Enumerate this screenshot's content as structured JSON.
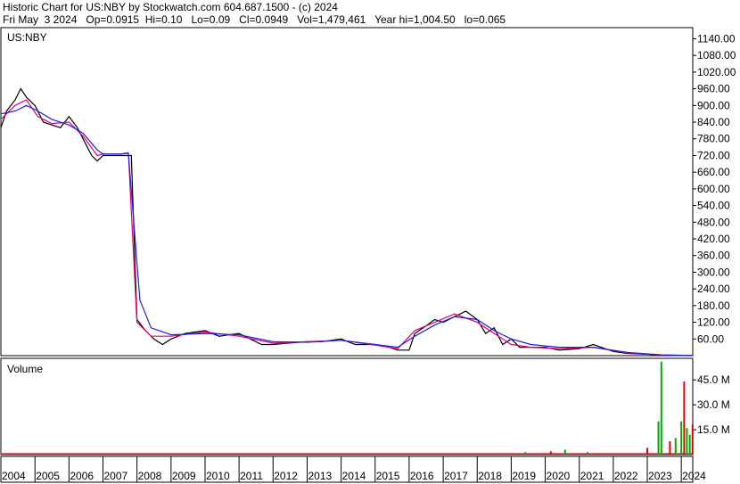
{
  "header": {
    "line1": "Historic Chart for US:NBY by Stockwatch.com 604.687.1500 - (c) 2024",
    "line2": "Fri May  3 2024   Op=0.0915  Hi=0.10   Lo=0.09   Cl=0.0949   Vol=1,479,461   Year hi=1,004.50   lo=0.065"
  },
  "colors": {
    "price": "#000000",
    "ma_short": "#e0007a",
    "ma_long": "#2020e0",
    "volume": "#00aa00",
    "volume_down": "#dd0000"
  },
  "chart_data": [
    {
      "type": "line",
      "title": "US:NBY",
      "ylim": [
        0,
        1180
      ],
      "yticks": [
        1140,
        1080,
        1020,
        960,
        900,
        840,
        780,
        720,
        660,
        600,
        540,
        480,
        420,
        360,
        300,
        240,
        180,
        120,
        60
      ],
      "x_ticks": [
        "2004",
        "2005",
        "2006",
        "2007",
        "2008",
        "2009",
        "2010",
        "2011",
        "2012",
        "2013",
        "2014",
        "2015",
        "2016",
        "2017",
        "2018",
        "2019",
        "2020",
        "2021",
        "2022",
        "2023",
        "2024"
      ],
      "x_range": [
        "2004-01-01",
        "2024-05-03"
      ],
      "series": [
        {
          "role": "price",
          "x": [
            "2004-01-01",
            "2004-03-01",
            "2004-06-01",
            "2004-08-01",
            "2004-10-01",
            "2005-01-01",
            "2005-04-01",
            "2005-07-01",
            "2005-10-01",
            "2006-01-01",
            "2006-04-01",
            "2006-06-01",
            "2006-09-01",
            "2006-11-01",
            "2007-01-01",
            "2007-06-01",
            "2007-09-01",
            "2007-11-01",
            "2008-01-01",
            "2008-04-01",
            "2008-07-01",
            "2008-10-01",
            "2009-01-01",
            "2009-06-01",
            "2010-01-01",
            "2010-06-01",
            "2011-01-01",
            "2011-05-01",
            "2011-09-01",
            "2012-01-01",
            "2012-06-01",
            "2013-01-01",
            "2013-06-01",
            "2014-01-01",
            "2014-06-01",
            "2015-01-01",
            "2015-06-01",
            "2015-09-01",
            "2016-01-01",
            "2016-03-01",
            "2016-06-01",
            "2016-10-01",
            "2017-01-01",
            "2017-05-01",
            "2017-09-01",
            "2018-01-01",
            "2018-04-01",
            "2018-07-01",
            "2018-10-01",
            "2019-01-01",
            "2019-04-01",
            "2019-08-01",
            "2020-01-01",
            "2020-06-01",
            "2021-01-01",
            "2021-06-01",
            "2022-01-01",
            "2022-06-01",
            "2023-01-01",
            "2023-06-01",
            "2024-01-01",
            "2024-05-03"
          ],
          "y": [
            820,
            880,
            920,
            960,
            930,
            900,
            840,
            830,
            820,
            860,
            820,
            780,
            720,
            700,
            720,
            720,
            720,
            720,
            130,
            90,
            60,
            40,
            60,
            80,
            90,
            70,
            80,
            60,
            40,
            40,
            45,
            50,
            50,
            60,
            40,
            40,
            30,
            20,
            20,
            80,
            100,
            130,
            120,
            140,
            160,
            130,
            80,
            100,
            40,
            60,
            30,
            30,
            30,
            20,
            25,
            40,
            15,
            8,
            5,
            2,
            0.2,
            0.1
          ]
        },
        {
          "role": "ma_short",
          "x": [
            "2004-01-01",
            "2004-06-01",
            "2004-10-01",
            "2005-02-01",
            "2005-07-01",
            "2006-01-01",
            "2006-06-01",
            "2006-11-01",
            "2007-01-01",
            "2007-07-01",
            "2007-10-01",
            "2008-01-01",
            "2008-06-01",
            "2009-01-01",
            "2010-01-01",
            "2011-01-01",
            "2012-01-01",
            "2013-01-01",
            "2014-01-01",
            "2015-01-01",
            "2015-09-01",
            "2016-03-01",
            "2016-10-01",
            "2017-05-01",
            "2018-01-01",
            "2018-07-01",
            "2019-01-01",
            "2019-08-01",
            "2020-06-01",
            "2021-06-01",
            "2022-06-01",
            "2023-06-01",
            "2024-05-03"
          ],
          "y": [
            850,
            900,
            920,
            860,
            835,
            840,
            790,
            720,
            725,
            725,
            730,
            120,
            70,
            70,
            85,
            70,
            45,
            50,
            55,
            38,
            25,
            90,
            120,
            150,
            120,
            80,
            40,
            30,
            25,
            30,
            10,
            2,
            0.3
          ]
        },
        {
          "role": "ma_long",
          "x": [
            "2004-01-01",
            "2004-06-01",
            "2004-10-01",
            "2005-02-01",
            "2005-07-01",
            "2006-01-01",
            "2006-06-01",
            "2006-11-01",
            "2007-01-01",
            "2007-07-01",
            "2007-10-01",
            "2008-02-01",
            "2008-06-01",
            "2009-01-01",
            "2010-01-01",
            "2011-01-01",
            "2012-01-01",
            "2013-01-01",
            "2014-01-01",
            "2015-01-01",
            "2015-09-01",
            "2016-03-01",
            "2016-10-01",
            "2017-05-01",
            "2018-01-01",
            "2018-07-01",
            "2019-01-01",
            "2019-08-01",
            "2020-06-01",
            "2021-06-01",
            "2022-06-01",
            "2023-06-01",
            "2024-05-03"
          ],
          "y": [
            870,
            880,
            900,
            880,
            850,
            830,
            800,
            740,
            725,
            725,
            728,
            200,
            100,
            75,
            80,
            75,
            50,
            48,
            55,
            40,
            30,
            70,
            110,
            140,
            130,
            90,
            60,
            40,
            30,
            30,
            12,
            3,
            0.5
          ]
        }
      ]
    },
    {
      "type": "bar",
      "title": "Volume",
      "ylabel_unit": "M",
      "ylim": [
        0,
        58
      ],
      "yticks": [
        15,
        30,
        45
      ],
      "ytick_labels": [
        "15.0 M",
        "30.0 M",
        "45.0 M"
      ],
      "spikes": {
        "x": [
          "2019-06-01",
          "2020-03-01",
          "2020-08-01",
          "2021-04-01",
          "2023-01-01",
          "2023-05-01",
          "2023-06-01",
          "2023-09-01",
          "2023-11-01",
          "2024-01-01",
          "2024-02-01",
          "2024-03-01",
          "2024-04-01",
          "2024-05-01"
        ],
        "values": [
          1.5,
          2,
          3,
          1.5,
          4,
          20,
          56,
          8,
          10,
          20,
          44,
          16,
          12,
          18
        ]
      }
    }
  ]
}
